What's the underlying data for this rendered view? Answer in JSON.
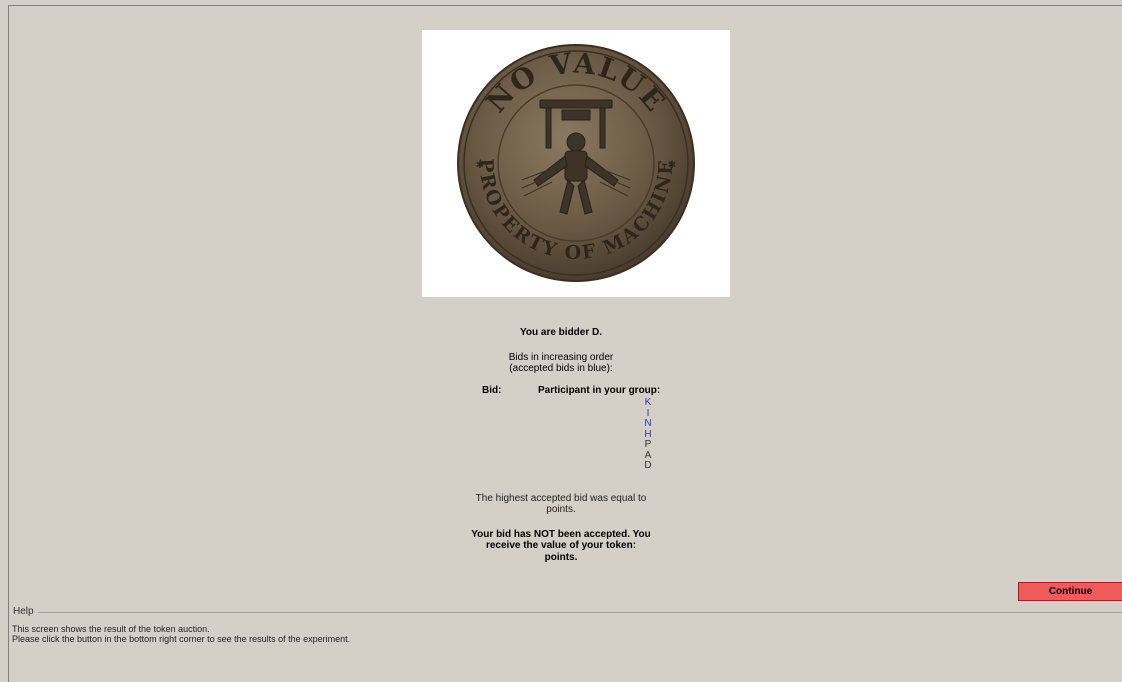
{
  "token": {
    "top_text": "NO VALUE",
    "bottom_text": "PROPERTY OF MACHINE",
    "background_color": "#ffffff",
    "coin_color": "#6b5a45"
  },
  "bidder": {
    "identity": "You are bidder D."
  },
  "bids": {
    "intro_line1": "Bids in increasing order",
    "intro_line2": "(accepted bids in blue):",
    "bid_header": "Bid:",
    "participant_header": "Participant in your group:",
    "participants": [
      {
        "letter": "K",
        "accepted": true
      },
      {
        "letter": "I",
        "accepted": true
      },
      {
        "letter": "N",
        "accepted": true
      },
      {
        "letter": "H",
        "accepted": true
      },
      {
        "letter": "P",
        "accepted": false
      },
      {
        "letter": "A",
        "accepted": false
      },
      {
        "letter": "D",
        "accepted": false
      }
    ]
  },
  "result": {
    "highest_line1": "The highest accepted bid was equal to",
    "highest_line2": "points.",
    "outcome_line1": "Your bid has NOT been accepted. You",
    "outcome_line2": "receive the value of your token:",
    "outcome_line3": "points."
  },
  "actions": {
    "continue_label": "Continue",
    "continue_color": "#f05a5a"
  },
  "help": {
    "label": "Help",
    "line1": "This screen shows the result of the token auction.",
    "line2": "Please click the button in the bottom right corner to see the results of the experiment."
  }
}
